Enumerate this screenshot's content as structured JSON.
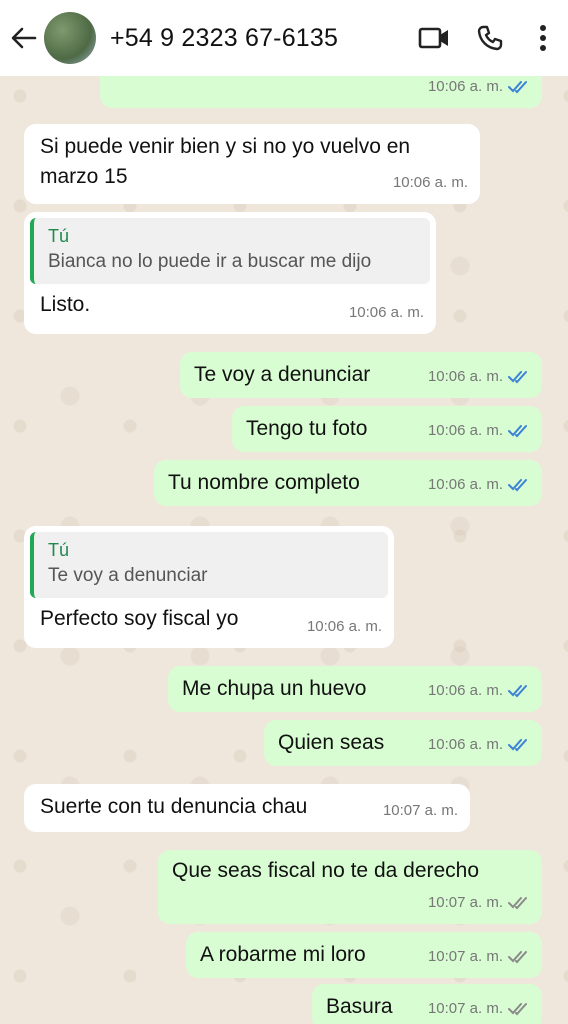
{
  "header": {
    "contact": "+54 9 2323 67-6135",
    "back_icon": "arrow-left-icon",
    "video_icon": "video-call-icon",
    "phone_icon": "phone-icon",
    "menu_icon": "more-vertical-icon"
  },
  "colors": {
    "outgoing_bubble": "#d9fdd3",
    "incoming_bubble": "#ffffff",
    "read_ticks": "#3b82d6",
    "delivered_ticks": "#8a8a8a",
    "quote_accent": "#1fa855"
  },
  "messages": [
    {
      "dir": "out",
      "text": "",
      "time": "10:06 a. m.",
      "status": "read"
    },
    {
      "dir": "in",
      "text": "Si puede venir bien y si no yo vuelvo en marzo 15",
      "time": "10:06 a. m."
    },
    {
      "dir": "in",
      "quote_author": "Tú",
      "quote_text": "Bianca no lo puede ir a buscar me dijo",
      "text": "Listo.",
      "time": "10:06 a. m."
    },
    {
      "dir": "out",
      "text": "Te voy a denunciar",
      "time": "10:06 a. m.",
      "status": "read"
    },
    {
      "dir": "out",
      "text": "Tengo tu foto",
      "time": "10:06 a. m.",
      "status": "read"
    },
    {
      "dir": "out",
      "text": "Tu nombre completo",
      "time": "10:06 a. m.",
      "status": "read"
    },
    {
      "dir": "in",
      "quote_author": "Tú",
      "quote_text": "Te voy a denunciar",
      "text": "Perfecto soy fiscal yo",
      "time": "10:06 a. m."
    },
    {
      "dir": "out",
      "text": "Me chupa un huevo",
      "time": "10:06 a. m.",
      "status": "read"
    },
    {
      "dir": "out",
      "text": "Quien seas",
      "time": "10:06 a. m.",
      "status": "read"
    },
    {
      "dir": "in",
      "text": "Suerte con tu denuncia chau",
      "time": "10:07 a. m."
    },
    {
      "dir": "out",
      "text": "Que seas fiscal no te da derecho",
      "time": "10:07 a. m.",
      "status": "delivered"
    },
    {
      "dir": "out",
      "text": "A robarme mi loro",
      "time": "10:07 a. m.",
      "status": "delivered"
    },
    {
      "dir": "out",
      "text": "Basura",
      "time": "10:07 a. m.",
      "status": "delivered"
    }
  ]
}
